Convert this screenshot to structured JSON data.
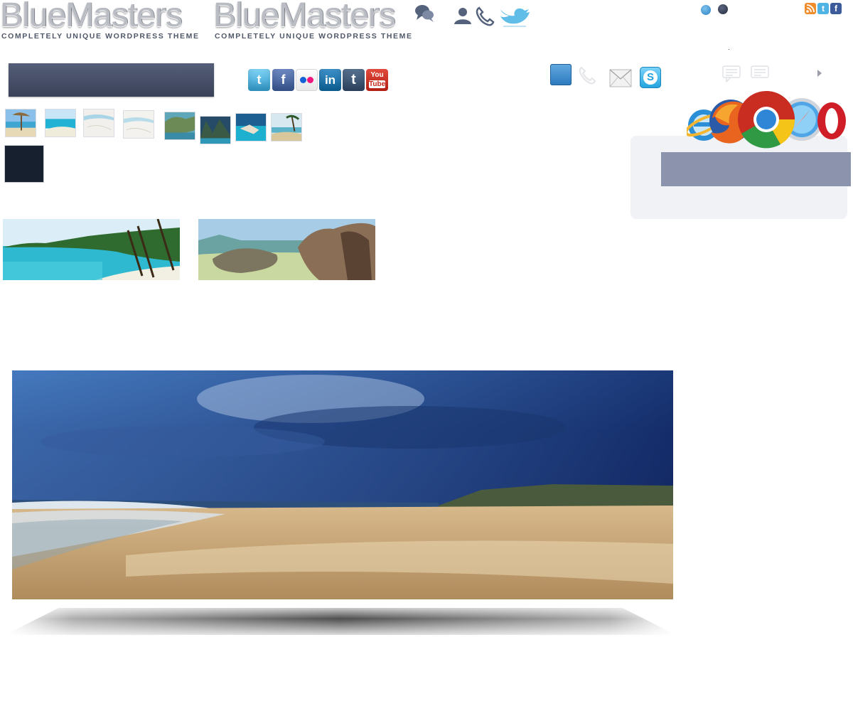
{
  "header": {
    "logos": [
      {
        "word": "BlueMasters",
        "tagline": "COMPLETELY UNIQUE WORDPRESS THEME"
      },
      {
        "word": "BlueMasters",
        "tagline": "COMPLETELY UNIQUE WORDPRESS THEME"
      }
    ],
    "icons": [
      "chat-bubbles-icon",
      "user-icon",
      "phone-icon",
      "twitter-bird-icon"
    ],
    "slider_dots": [
      "slider-dot-1",
      "slider-dot-2"
    ],
    "feed_icons": [
      "rss-icon",
      "twitter-icon",
      "facebook-icon"
    ]
  },
  "search_bar": {
    "value": ""
  },
  "social_row": [
    "twitter",
    "facebook",
    "flickr",
    "linkedin",
    "tumblr",
    "youtube"
  ],
  "social_text": {
    "twitter": "t",
    "facebook": "f",
    "linkedin": "in",
    "tumblr": "t",
    "youtube_top": "You",
    "youtube_bottom": "Tube"
  },
  "contact_icons": [
    "blue-square-icon",
    "phone-outline-icon",
    "mail-icon",
    "skype-icon"
  ],
  "contact_text": {
    "skype": "S"
  },
  "browsers": [
    "internet-explorer",
    "firefox",
    "chrome",
    "safari",
    "opera"
  ],
  "browser_text": {
    "opera": "O"
  },
  "colors": {
    "header_bar": "#3f4760",
    "sidebar_panel": "#f1f2f6",
    "sidebar_bar": "#8c93ac",
    "dark_tile": "#17202f",
    "dot_light": "#3f8fc9",
    "dot_dark": "#2d3548"
  }
}
